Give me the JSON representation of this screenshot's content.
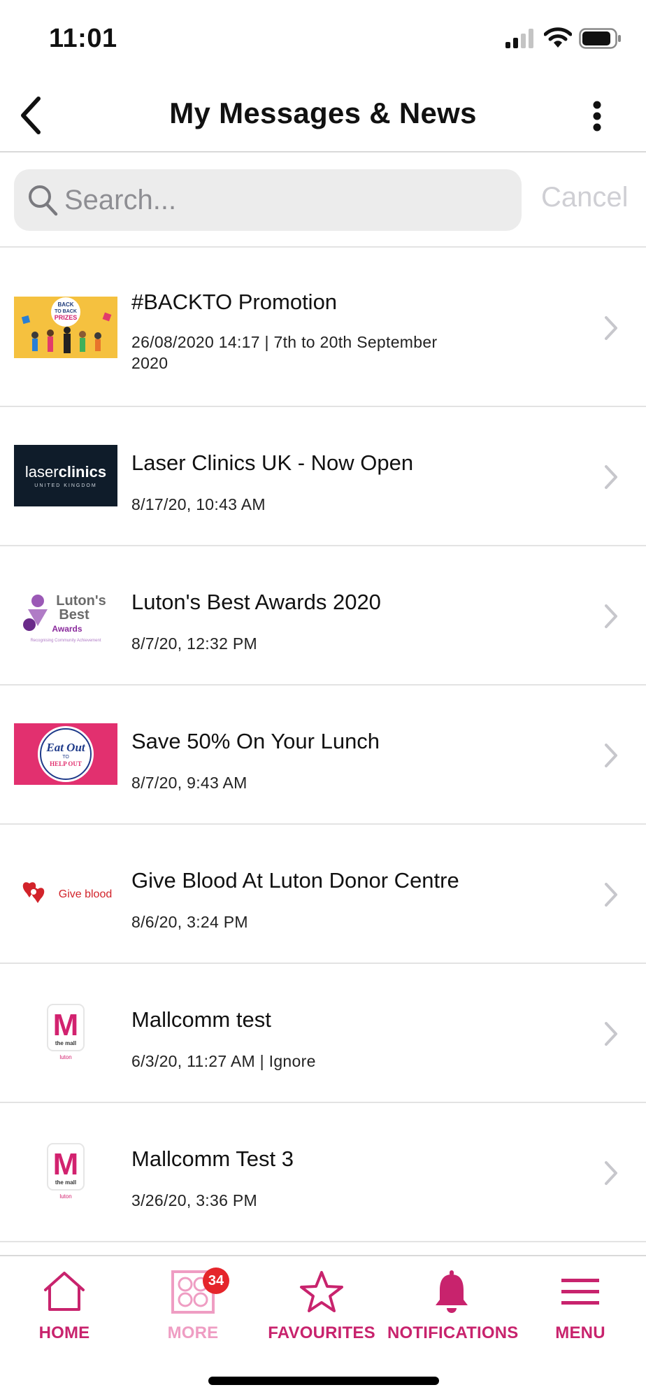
{
  "status_bar": {
    "time": "11:01"
  },
  "nav": {
    "title": "My Messages & News",
    "back_icon": "back-chevron-icon",
    "menu_icon": "kebab-icon"
  },
  "search": {
    "placeholder": "Search...",
    "cancel_label": "Cancel"
  },
  "messages": [
    {
      "title": "#BACKTO Promotion",
      "meta": "26/08/2020 14:17 | 7th to 20th September 2020",
      "thumb": {
        "line1": "BACK",
        "line2": "TO BACK",
        "line3": "PRIZES"
      }
    },
    {
      "title": "Laser Clinics UK - Now Open",
      "meta": "8/17/20, 10:43 AM",
      "thumb": {
        "brand_a": "laser",
        "brand_b": "clinics",
        "sub": "UNITED KINGDOM"
      }
    },
    {
      "title": "Luton's Best Awards 2020",
      "meta": "8/7/20, 12:32 PM",
      "thumb": {
        "line1": "Luton's",
        "line2": "Best",
        "line3": "Awards",
        "tagline": "Recognising Community Achievement"
      }
    },
    {
      "title": "Save 50% On Your Lunch",
      "meta": "8/7/20, 9:43 AM",
      "thumb": {
        "line1": "Eat Out",
        "line2": "TO",
        "line3": "HELP OUT"
      }
    },
    {
      "title": "Give Blood At Luton Donor Centre",
      "meta": "8/6/20, 3:24 PM",
      "thumb": {
        "text": "Give blood"
      }
    },
    {
      "title": "Mallcomm test",
      "meta": "6/3/20, 11:27 AM | Ignore",
      "thumb": {
        "letter": "M",
        "sub": "the mall",
        "loc": "luton"
      }
    },
    {
      "title": "Mallcomm Test 3",
      "meta": "3/26/20, 3:36 PM",
      "thumb": {
        "letter": "M",
        "sub": "the mall",
        "loc": "luton"
      }
    }
  ],
  "tabs": [
    {
      "label": "HOME",
      "icon": "home-icon"
    },
    {
      "label": "MORE",
      "icon": "grid-icon",
      "badge": "34"
    },
    {
      "label": "FAVOURITES",
      "icon": "star-icon"
    },
    {
      "label": "NOTIFICATIONS",
      "icon": "bell-icon"
    },
    {
      "label": "MENU",
      "icon": "hamburger-icon"
    }
  ],
  "colors": {
    "accent": "#c8236d",
    "accent_faded": "#ef9dc3",
    "badge": "#e5252b",
    "chevron": "#c7c7cc"
  }
}
